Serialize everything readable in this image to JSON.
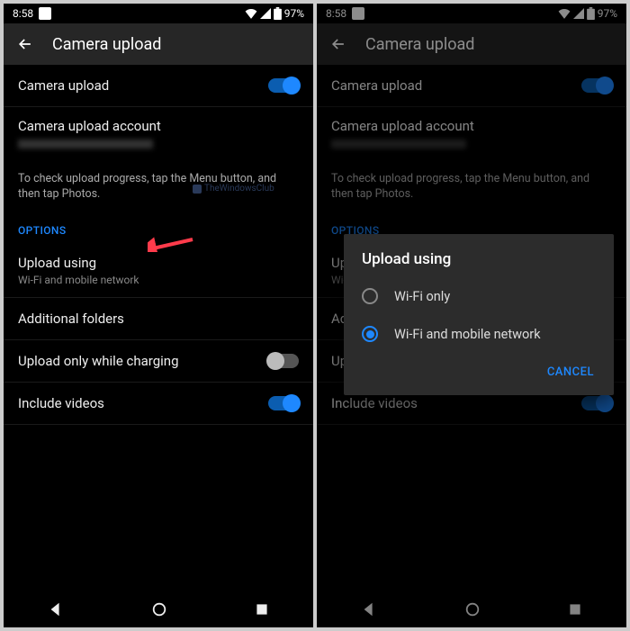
{
  "status": {
    "time": "8:58",
    "battery": "97%"
  },
  "appbar": {
    "title": "Camera upload"
  },
  "settings": {
    "camera_upload_label": "Camera upload",
    "account_label": "Camera upload account",
    "helper_text": "To check upload progress, tap the Menu button, and then tap Photos.",
    "options_header": "OPTIONS",
    "upload_using_label": "Upload using",
    "upload_using_value": "Wi-Fi and mobile network",
    "additional_folders_label": "Additional folders",
    "charging_label": "Upload only while charging",
    "include_videos_label": "Include videos"
  },
  "dialog": {
    "title": "Upload using",
    "option_wifi": "Wi-Fi only",
    "option_both": "Wi-Fi and mobile network",
    "cancel": "CANCEL"
  },
  "watermark": "TheWindowsClub"
}
